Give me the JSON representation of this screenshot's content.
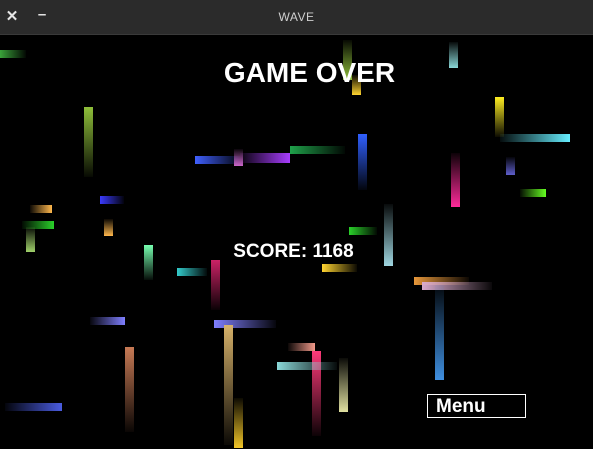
{
  "window": {
    "title": "WAVE",
    "close_icon": "close-icon",
    "minimize_icon": "minimize-icon"
  },
  "game": {
    "over_text": "GAME OVER",
    "score_label": "SCORE:",
    "score_value": "1168",
    "menu_label": "Menu"
  },
  "trail_colors": [
    "#3aa33a",
    "#8fbf3a",
    "#5a9a60",
    "#4060ff",
    "#a83dff",
    "#cc66cc",
    "#1fa14a",
    "#3060ff",
    "#6ef",
    "#ff2a9a",
    "#ffee22",
    "#66ff22",
    "#5e5ecc",
    "#ffb84d",
    "#3b3bff",
    "#2ad12a",
    "#9fd06a",
    "#77ffb0",
    "#33cccc",
    "#cc2266",
    "#9fd6e0",
    "#ffd430",
    "#e7973a",
    "#d8aacc",
    "#3f8fe0",
    "#7f7fff",
    "#c77a55",
    "#d7b26a",
    "#f29a8a",
    "#8ad8d8",
    "#e0e0a0",
    "#ff3a7a",
    "#f2c628",
    "#4a5ce0"
  ]
}
